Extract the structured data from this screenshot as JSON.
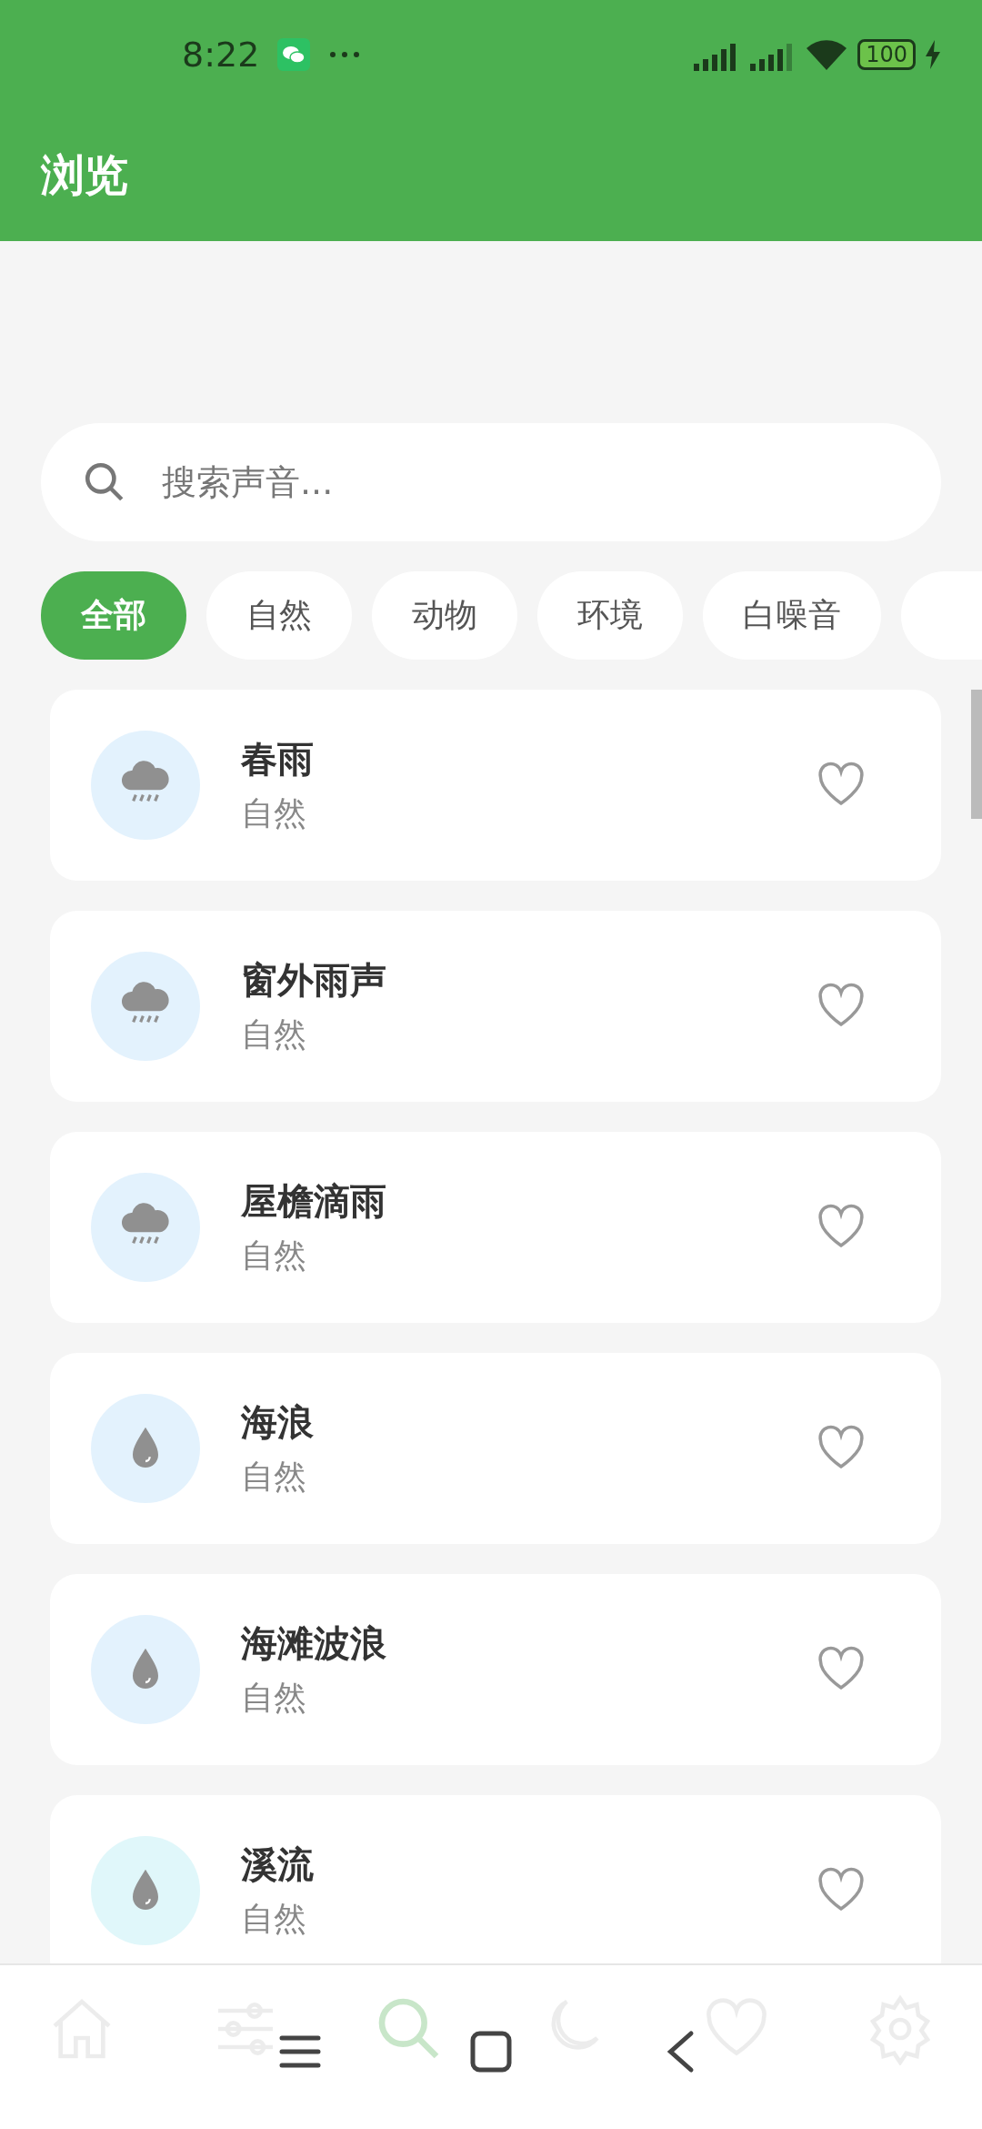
{
  "status_bar": {
    "time": "8:22",
    "battery": "100"
  },
  "header": {
    "title": "浏览"
  },
  "search": {
    "placeholder": "搜索声音..."
  },
  "categories": [
    {
      "label": "全部",
      "selected": true
    },
    {
      "label": "自然",
      "selected": false
    },
    {
      "label": "动物",
      "selected": false
    },
    {
      "label": "环境",
      "selected": false
    },
    {
      "label": "白噪音",
      "selected": false
    },
    {
      "selected": false
    }
  ],
  "sounds": [
    {
      "title": "春雨",
      "category": "自然",
      "kind": "rain",
      "color": "#e3f2fd",
      "favorite": false
    },
    {
      "title": "窗外雨声",
      "category": "自然",
      "kind": "rain",
      "color": "#e3f2fd",
      "favorite": false
    },
    {
      "title": "屋檐滴雨",
      "category": "自然",
      "kind": "rain",
      "color": "#e3f2fd",
      "favorite": false
    },
    {
      "title": "海浪",
      "category": "自然",
      "kind": "drop",
      "color": "#e3f2fd",
      "favorite": false
    },
    {
      "title": "海滩波浪",
      "category": "自然",
      "kind": "drop",
      "color": "#e3f2fd",
      "favorite": false
    },
    {
      "title": "溪流",
      "category": "自然",
      "kind": "drop",
      "color": "#e0f7fa",
      "favorite": false
    }
  ],
  "bottom_nav": [
    {
      "kind": "home",
      "selected": false
    },
    {
      "kind": "sliders",
      "selected": false
    },
    {
      "kind": "search",
      "selected": true
    },
    {
      "kind": "moon",
      "selected": false
    },
    {
      "kind": "heart",
      "selected": false
    },
    {
      "kind": "settings",
      "selected": false
    }
  ]
}
